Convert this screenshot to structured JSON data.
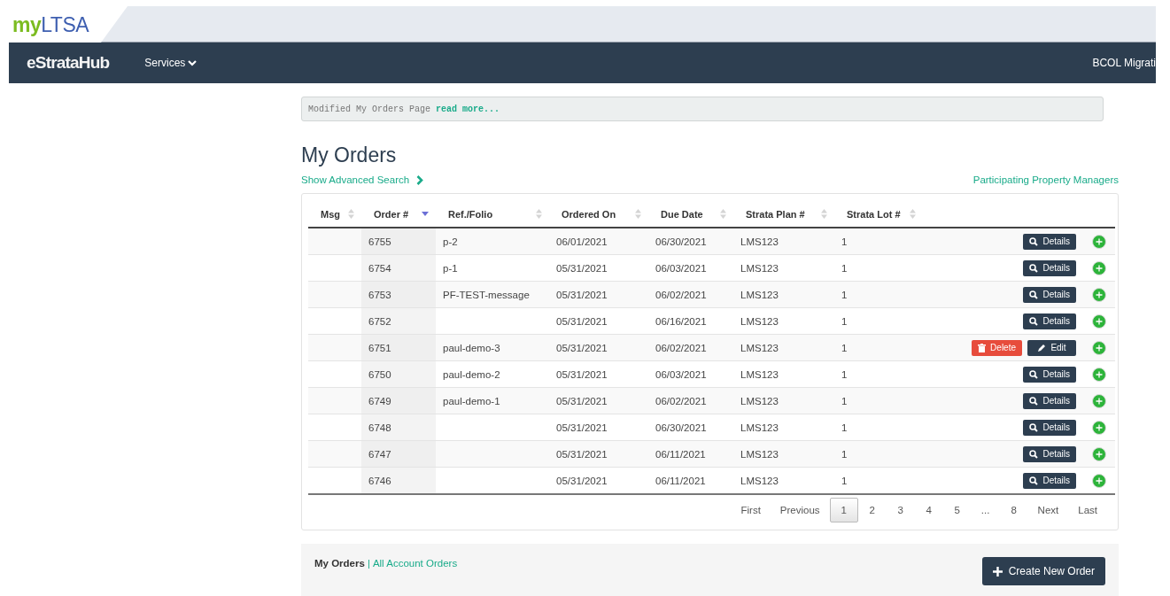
{
  "brand": {
    "prefix": "my",
    "name": "LTSA"
  },
  "navbar": {
    "app_name": "eStrataHub",
    "menu": "Services",
    "user": "BCOL Migrati"
  },
  "notice": {
    "text": "Modified My Orders Page",
    "link": "read more..."
  },
  "title": "My Orders",
  "advanced_search": "Show Advanced Search",
  "managers_link": "Participating Property Managers",
  "table": {
    "columns": [
      {
        "label": "Msg",
        "sorted": false
      },
      {
        "label": "Order #",
        "sorted": true
      },
      {
        "label": "Ref./Folio",
        "sorted": false
      },
      {
        "label": "Ordered On",
        "sorted": false
      },
      {
        "label": "Due Date",
        "sorted": false
      },
      {
        "label": "Strata Plan #",
        "sorted": false
      },
      {
        "label": "Strata Lot #",
        "sorted": false
      }
    ],
    "rows": [
      {
        "order": "6755",
        "ref": "p-2",
        "ordered_on": "06/01/2021",
        "due": "06/30/2021",
        "plan": "LMS123",
        "lot": "1",
        "kind": "details",
        "actions": [
          "Details"
        ]
      },
      {
        "order": "6754",
        "ref": "p-1",
        "ordered_on": "05/31/2021",
        "due": "06/03/2021",
        "plan": "LMS123",
        "lot": "1",
        "kind": "details",
        "actions": [
          "Details"
        ]
      },
      {
        "order": "6753",
        "ref": "PF-TEST-message",
        "ordered_on": "05/31/2021",
        "due": "06/02/2021",
        "plan": "LMS123",
        "lot": "1",
        "kind": "details",
        "actions": [
          "Details"
        ]
      },
      {
        "order": "6752",
        "ordered_on": "05/31/2021",
        "due": "06/16/2021",
        "plan": "LMS123",
        "lot": "1",
        "kind": "details",
        "actions": [
          "Details"
        ]
      },
      {
        "order": "6751",
        "ref": "paul-demo-3",
        "ordered_on": "05/31/2021",
        "due": "06/02/2021",
        "plan": "LMS123",
        "lot": "1",
        "kind": "draft",
        "actions": [
          "Delete",
          "Edit"
        ]
      },
      {
        "order": "6750",
        "ref": "paul-demo-2",
        "ordered_on": "05/31/2021",
        "due": "06/03/2021",
        "plan": "LMS123",
        "lot": "1",
        "kind": "details",
        "actions": [
          "Details"
        ]
      },
      {
        "order": "6749",
        "ref": "paul-demo-1",
        "ordered_on": "05/31/2021",
        "due": "06/02/2021",
        "plan": "LMS123",
        "lot": "1",
        "kind": "details",
        "actions": [
          "Details"
        ]
      },
      {
        "order": "6748",
        "ordered_on": "05/31/2021",
        "due": "06/30/2021",
        "plan": "LMS123",
        "lot": "1",
        "kind": "details",
        "actions": [
          "Details"
        ]
      },
      {
        "order": "6747",
        "ordered_on": "05/31/2021",
        "due": "06/11/2021",
        "plan": "LMS123",
        "lot": "1",
        "kind": "details",
        "actions": [
          "Details"
        ]
      },
      {
        "order": "6746",
        "ordered_on": "05/31/2021",
        "due": "06/11/2021",
        "plan": "LMS123",
        "lot": "1",
        "kind": "details",
        "actions": [
          "Details"
        ]
      }
    ]
  },
  "pagination": [
    {
      "label": "First",
      "selected": false
    },
    {
      "label": "Previous",
      "selected": false
    },
    {
      "label": "1",
      "selected": true
    },
    {
      "label": "2",
      "selected": false
    },
    {
      "label": "3",
      "selected": false
    },
    {
      "label": "4",
      "selected": false
    },
    {
      "label": "5",
      "selected": false
    },
    {
      "label": "...",
      "selected": false
    },
    {
      "label": "8",
      "selected": false
    },
    {
      "label": "Next",
      "selected": false
    },
    {
      "label": "Last",
      "selected": false
    }
  ],
  "footer": {
    "current": "My Orders",
    "separator": "|",
    "other": "All Account Orders",
    "create_button": "Create New Order"
  }
}
